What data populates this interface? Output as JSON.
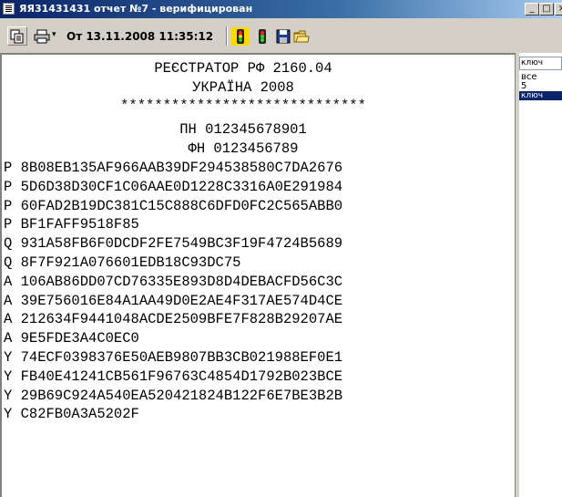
{
  "window": {
    "title": "ЯЯ31431431 отчет №7 - верифицирован",
    "min_glyph": "_",
    "max_glyph": "□",
    "close_glyph": "×"
  },
  "toolbar": {
    "icons": [
      "copy-icon",
      "printer-icon",
      "traffic-light-icon",
      "traffic-light-green-icon",
      "floppy-save-icon",
      "folder-open-icon"
    ],
    "print_dropdown_glyph": "▾",
    "date_label": "От 13.11.2008 11:35:12"
  },
  "receipt": {
    "header": {
      "line1": "РЕЄСТРАТОР РФ 2160.04",
      "line2": "УКРАЇНА 2008",
      "stars": "*****************************",
      "pn": "ПН 012345678901",
      "fn": "ФН 0123456789"
    },
    "rows": [
      {
        "tag": "P",
        "value": "8B08EB135AF966AAB39DF294538580C7DA2676"
      },
      {
        "tag": "P",
        "value": "5D6D38D30CF1C06AAE0D1228C3316A0E291984"
      },
      {
        "tag": "P",
        "value": "60FAD2B19DC381C15C888C6DFD0FC2C565ABB0"
      },
      {
        "tag": "P",
        "value": "BF1FAFF9518F85"
      },
      {
        "tag": "Q",
        "value": "931A58FB6F0DCDF2FE7549BC3F19F4724B5689"
      },
      {
        "tag": "Q",
        "value": "8F7F921A076601EDB18C93DC75"
      },
      {
        "tag": "A",
        "value": "106AB86DD07CD76335E893D8D4DEBACFD56C3C"
      },
      {
        "tag": "A",
        "value": "39E756016E84A1AA49D0E2AE4F317AE574D4CE"
      },
      {
        "tag": "A",
        "value": "212634F9441048ACDE2509BFE7F828B29207AE"
      },
      {
        "tag": "A",
        "value": "9E5FDE3A4C0EC0"
      },
      {
        "tag": "Y",
        "value": "74ECF0398376E50AEB9807BB3CB021988EF0E1"
      },
      {
        "tag": "Y",
        "value": "FB40E41241CB561F96763C4854D1792B023BCE"
      },
      {
        "tag": "Y",
        "value": "29B69C924A540EA520421824B122F6E7BE3B2B"
      },
      {
        "tag": "Y",
        "value": "C82FB0A3A5202F"
      }
    ]
  },
  "right_pane": {
    "key_input_value": "ключ",
    "list_items": [
      "все",
      "5",
      "ключ"
    ],
    "selected_index": 2
  }
}
